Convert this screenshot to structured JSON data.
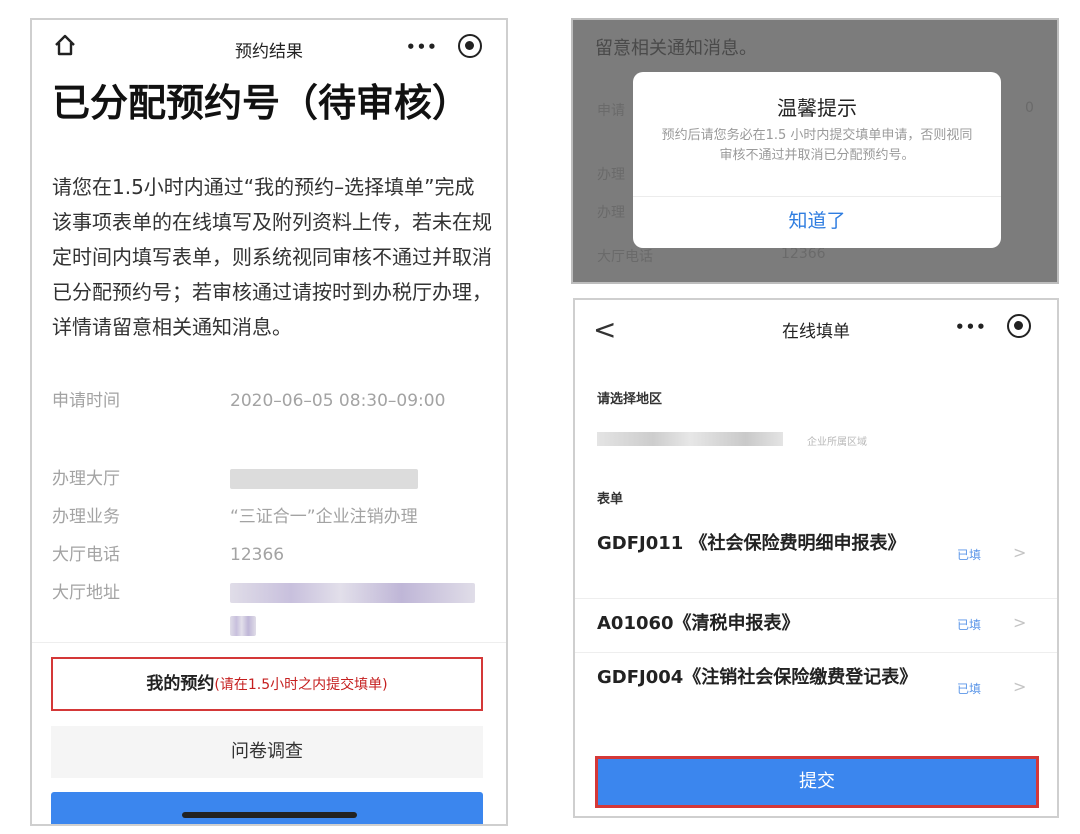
{
  "left_screen": {
    "nav_title": "预约结果",
    "nav_more": "•••",
    "headline": "已分配预约号（待审核）",
    "description": "请您在1.5小时内通过“我的预约–选择填单”完成该事项表单的在线填写及附列资料上传，若未在规定时间内填写表单，则系统视同审核不通过并取消已分配预约号；若审核通过请按时到办税厅办理，详情请留意相关通知消息。",
    "info": {
      "apply_time_label": "申请时间",
      "apply_time_value": "2020–06–05 08:30–09:00",
      "hall_label": "办理大厅",
      "business_label": "办理业务",
      "business_value": "“三证合一”企业注销办理",
      "phone_label": "大厅电话",
      "phone_value": "12366",
      "address_label": "大厅地址"
    },
    "btn_appoint_main": "我的预约",
    "btn_appoint_hint": "(请在1.5小时之内提交填单)",
    "btn_survey": "问卷调查"
  },
  "modal_screen": {
    "bg_text_top": "留意相关通知消息。",
    "bg_label_1": "申请",
    "bg_label_2": "办理",
    "bg_label_3": "办理",
    "bg_label_4": "大厅电话",
    "bg_value_4": "12366",
    "bg_value_1": "0",
    "modal_title": "温馨提示",
    "modal_body": "预约后请您务必在1.5 小时内提交填单申请，否则视同审核不通过并取消已分配预约号。",
    "modal_button": "知道了"
  },
  "right_screen": {
    "nav_back": "<",
    "nav_title": "在线填单",
    "nav_more": "•••",
    "region_label": "请选择地区",
    "region_hint": "企业所属区域",
    "forms_label": "表单",
    "forms": [
      {
        "title": "GDFJ011 《社会保险费明细申报表》",
        "status": "已填",
        "chevron": ">"
      },
      {
        "title": "A01060《清税申报表》",
        "status": "已填",
        "chevron": ">"
      },
      {
        "title": "GDFJ004《注销社会保险缴费登记表》",
        "status": "已填",
        "chevron": ">"
      }
    ],
    "submit_label": "提交"
  }
}
